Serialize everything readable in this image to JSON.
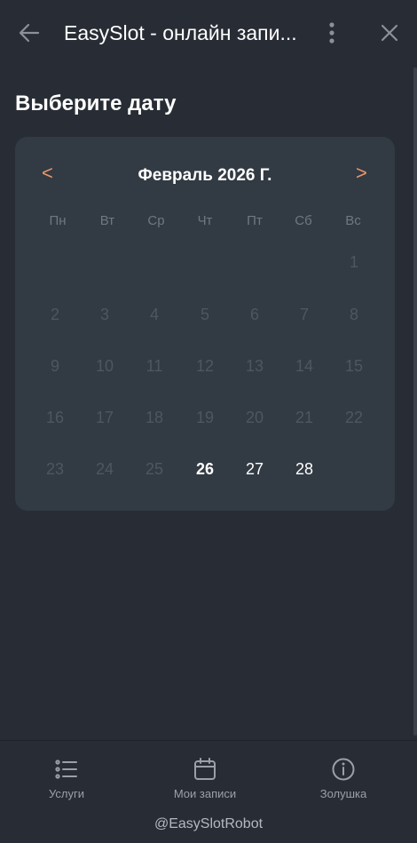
{
  "header": {
    "title": "EasySlot - онлайн запи...",
    "back_icon": "arrow-left-icon",
    "more_icon": "more-vertical-icon",
    "close_icon": "close-icon"
  },
  "page": {
    "heading": "Выберите дату"
  },
  "calendar": {
    "prev": "<",
    "next": ">",
    "month": "Февраль 2026 Г.",
    "weekdays": [
      "Пн",
      "Вт",
      "Ср",
      "Чт",
      "Пт",
      "Сб",
      "Вс"
    ],
    "weeks": [
      [
        "",
        "",
        "",
        "",
        "",
        "",
        "1"
      ],
      [
        "2",
        "3",
        "4",
        "5",
        "6",
        "7",
        "8"
      ],
      [
        "9",
        "10",
        "11",
        "12",
        "13",
        "14",
        "15"
      ],
      [
        "16",
        "17",
        "18",
        "19",
        "20",
        "21",
        "22"
      ],
      [
        "23",
        "24",
        "25",
        "26",
        "27",
        "28",
        ""
      ]
    ],
    "today": "26",
    "available": [
      "26",
      "27",
      "28"
    ],
    "accent_color": "#e9976a"
  },
  "bottom_nav": {
    "items": [
      {
        "label": "Услуги",
        "icon": "list-icon"
      },
      {
        "label": "Мои записи",
        "icon": "calendar-icon"
      },
      {
        "label": "Золушка",
        "icon": "info-icon"
      }
    ]
  },
  "footer": {
    "bot_handle": "@EasySlotRobot"
  }
}
